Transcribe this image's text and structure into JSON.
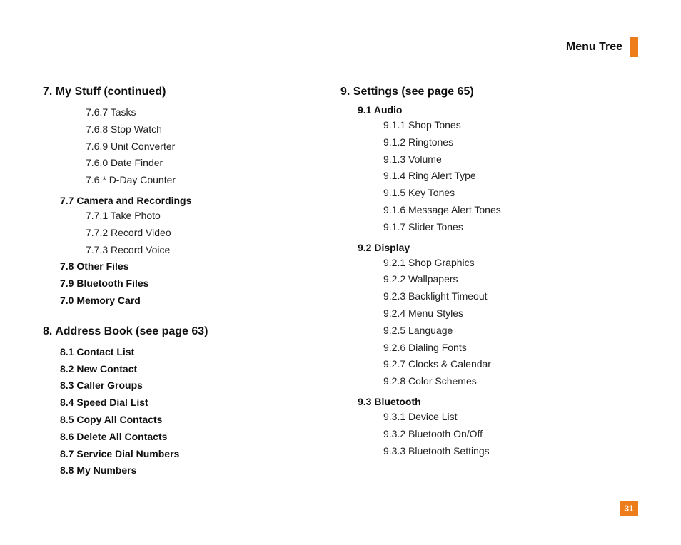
{
  "header": {
    "title": "Menu Tree"
  },
  "page_number": "31",
  "left": {
    "section7": {
      "heading": "7.  My Stuff (continued)",
      "items_top": [
        "7.6.7 Tasks",
        "7.6.8 Stop Watch",
        "7.6.9 Unit Converter",
        "7.6.0 Date Finder",
        "7.6.* D-Day Counter"
      ],
      "sub77": {
        "heading": "7.7 Camera and Recordings",
        "items": [
          "7.7.1 Take Photo",
          "7.7.2 Record Video",
          "7.7.3 Record Voice"
        ]
      },
      "bottom_bold": [
        "7.8 Other Files",
        "7.9 Bluetooth Files",
        "7.0 Memory Card"
      ]
    },
    "section8": {
      "heading": "8.  Address Book (see page 63)",
      "bold_items": [
        "8.1 Contact List",
        "8.2 New Contact",
        "8.3 Caller Groups",
        "8.4 Speed Dial List",
        "8.5 Copy All Contacts",
        "8.6 Delete All Contacts",
        "8.7 Service Dial Numbers",
        "8.8 My Numbers"
      ]
    }
  },
  "right": {
    "section9": {
      "heading": "9.  Settings (see page 65)",
      "sub91": {
        "heading": "9.1 Audio",
        "items": [
          "9.1.1 Shop Tones",
          "9.1.2 Ringtones",
          "9.1.3 Volume",
          "9.1.4 Ring Alert Type",
          "9.1.5 Key Tones",
          "9.1.6 Message Alert Tones",
          "9.1.7 Slider Tones"
        ]
      },
      "sub92": {
        "heading": "9.2 Display",
        "items": [
          "9.2.1 Shop Graphics",
          "9.2.2 Wallpapers",
          "9.2.3 Backlight Timeout",
          "9.2.4 Menu Styles",
          "9.2.5 Language",
          "9.2.6 Dialing Fonts",
          "9.2.7 Clocks & Calendar",
          "9.2.8 Color Schemes"
        ]
      },
      "sub93": {
        "heading": "9.3 Bluetooth",
        "items": [
          "9.3.1 Device List",
          "9.3.2 Bluetooth On/Off",
          "9.3.3 Bluetooth Settings"
        ]
      }
    }
  }
}
